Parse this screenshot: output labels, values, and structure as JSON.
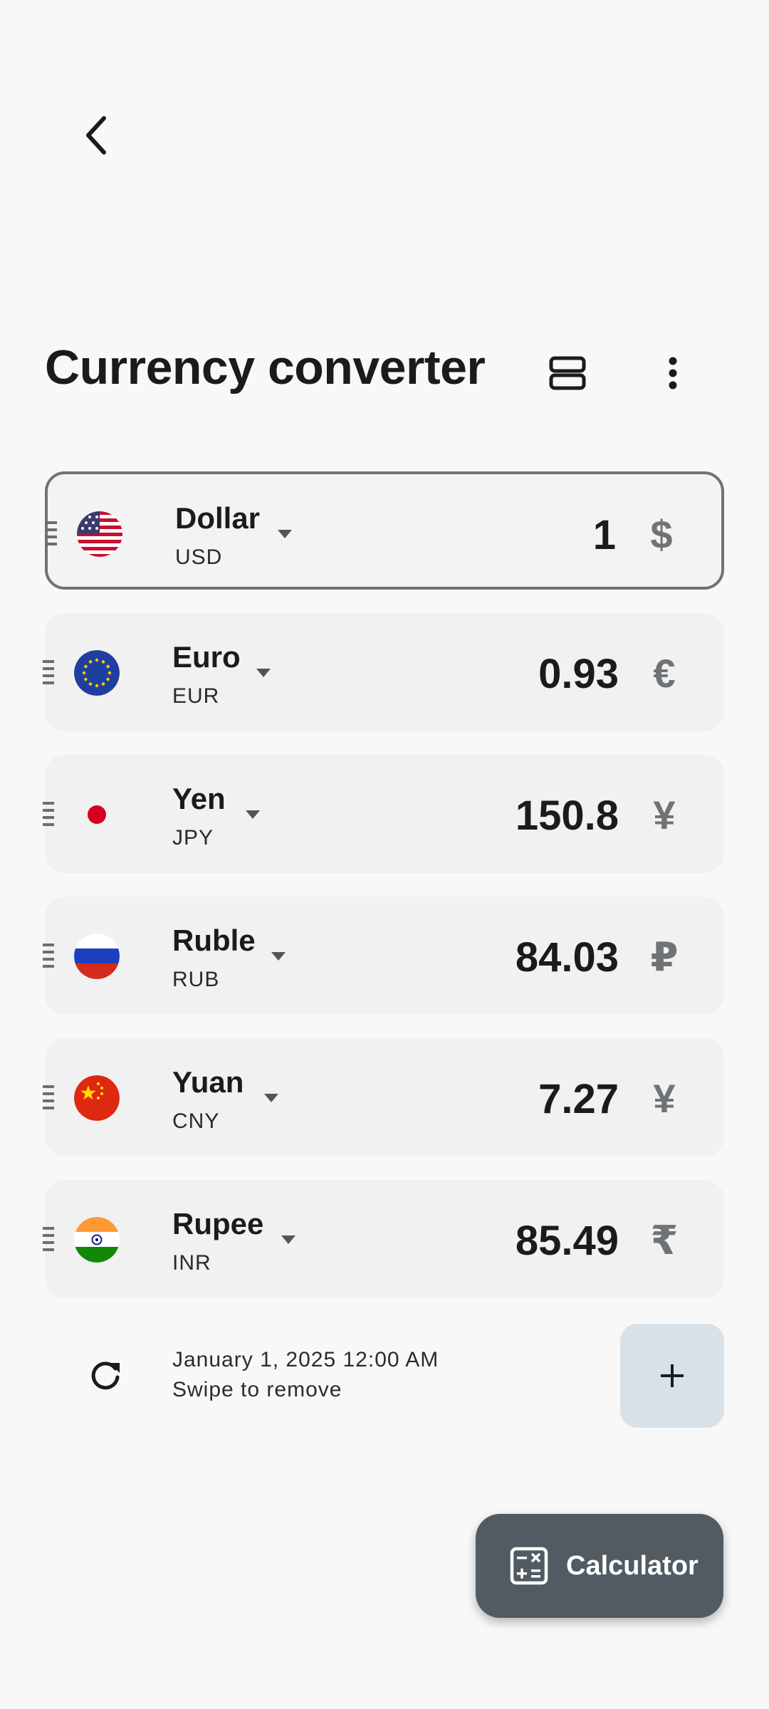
{
  "header": {
    "title": "Currency converter"
  },
  "currencies": [
    {
      "name": "Dollar",
      "code": "USD",
      "value": "1",
      "symbol": "$",
      "flag": "us-flag-icon",
      "selected": true
    },
    {
      "name": "Euro",
      "code": "EUR",
      "value": "0.93",
      "symbol": "€",
      "flag": "eu-flag-icon",
      "selected": false
    },
    {
      "name": "Yen",
      "code": "JPY",
      "value": "150.8",
      "symbol": "¥",
      "flag": "jp-flag-icon",
      "selected": false
    },
    {
      "name": "Ruble",
      "code": "RUB",
      "value": "84.03",
      "symbol": "₽",
      "flag": "ru-flag-icon",
      "selected": false
    },
    {
      "name": "Yuan",
      "code": "CNY",
      "value": "7.27",
      "symbol": "¥",
      "flag": "cn-flag-icon",
      "selected": false
    },
    {
      "name": "Rupee",
      "code": "INR",
      "value": "85.49",
      "symbol": "₹",
      "flag": "in-flag-icon",
      "selected": false
    }
  ],
  "footer": {
    "timestamp": "January 1, 2025 12:00 AM",
    "hint": "Swipe to remove"
  },
  "fab": {
    "label": "Calculator"
  },
  "colors": {
    "background": "#f8f8f8",
    "card": "#f1f1f1",
    "selected_border": "#6e7378",
    "add_button": "#d8e1e7",
    "fab": "#525b61"
  }
}
